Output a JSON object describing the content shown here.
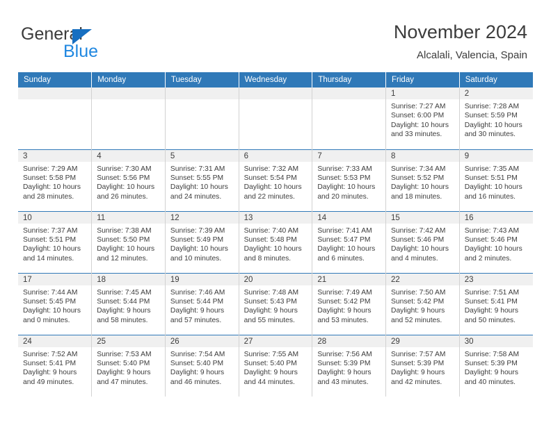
{
  "brand": {
    "name_top": "General",
    "name_bottom": "Blue",
    "accent_color": "#1f87e0",
    "triangle_color": "#176fc1"
  },
  "header": {
    "title": "November 2024",
    "subtitle": "Alcalali, Valencia, Spain",
    "header_bg": "#3079b8",
    "header_text_color": "#ffffff"
  },
  "weekdays": [
    "Sunday",
    "Monday",
    "Tuesday",
    "Wednesday",
    "Thursday",
    "Friday",
    "Saturday"
  ],
  "labels": {
    "sunrise": "Sunrise:",
    "sunset": "Sunset:",
    "daylight": "Daylight:"
  },
  "weeks": [
    [
      {
        "empty": true
      },
      {
        "empty": true
      },
      {
        "empty": true
      },
      {
        "empty": true
      },
      {
        "empty": true
      },
      {
        "day": "1",
        "sunrise": "Sunrise: 7:27 AM",
        "sunset": "Sunset: 6:00 PM",
        "daylight_line1": "Daylight: 10 hours",
        "daylight_line2": "and 33 minutes."
      },
      {
        "day": "2",
        "sunrise": "Sunrise: 7:28 AM",
        "sunset": "Sunset: 5:59 PM",
        "daylight_line1": "Daylight: 10 hours",
        "daylight_line2": "and 30 minutes."
      }
    ],
    [
      {
        "day": "3",
        "sunrise": "Sunrise: 7:29 AM",
        "sunset": "Sunset: 5:58 PM",
        "daylight_line1": "Daylight: 10 hours",
        "daylight_line2": "and 28 minutes."
      },
      {
        "day": "4",
        "sunrise": "Sunrise: 7:30 AM",
        "sunset": "Sunset: 5:56 PM",
        "daylight_line1": "Daylight: 10 hours",
        "daylight_line2": "and 26 minutes."
      },
      {
        "day": "5",
        "sunrise": "Sunrise: 7:31 AM",
        "sunset": "Sunset: 5:55 PM",
        "daylight_line1": "Daylight: 10 hours",
        "daylight_line2": "and 24 minutes."
      },
      {
        "day": "6",
        "sunrise": "Sunrise: 7:32 AM",
        "sunset": "Sunset: 5:54 PM",
        "daylight_line1": "Daylight: 10 hours",
        "daylight_line2": "and 22 minutes."
      },
      {
        "day": "7",
        "sunrise": "Sunrise: 7:33 AM",
        "sunset": "Sunset: 5:53 PM",
        "daylight_line1": "Daylight: 10 hours",
        "daylight_line2": "and 20 minutes."
      },
      {
        "day": "8",
        "sunrise": "Sunrise: 7:34 AM",
        "sunset": "Sunset: 5:52 PM",
        "daylight_line1": "Daylight: 10 hours",
        "daylight_line2": "and 18 minutes."
      },
      {
        "day": "9",
        "sunrise": "Sunrise: 7:35 AM",
        "sunset": "Sunset: 5:51 PM",
        "daylight_line1": "Daylight: 10 hours",
        "daylight_line2": "and 16 minutes."
      }
    ],
    [
      {
        "day": "10",
        "sunrise": "Sunrise: 7:37 AM",
        "sunset": "Sunset: 5:51 PM",
        "daylight_line1": "Daylight: 10 hours",
        "daylight_line2": "and 14 minutes."
      },
      {
        "day": "11",
        "sunrise": "Sunrise: 7:38 AM",
        "sunset": "Sunset: 5:50 PM",
        "daylight_line1": "Daylight: 10 hours",
        "daylight_line2": "and 12 minutes."
      },
      {
        "day": "12",
        "sunrise": "Sunrise: 7:39 AM",
        "sunset": "Sunset: 5:49 PM",
        "daylight_line1": "Daylight: 10 hours",
        "daylight_line2": "and 10 minutes."
      },
      {
        "day": "13",
        "sunrise": "Sunrise: 7:40 AM",
        "sunset": "Sunset: 5:48 PM",
        "daylight_line1": "Daylight: 10 hours",
        "daylight_line2": "and 8 minutes."
      },
      {
        "day": "14",
        "sunrise": "Sunrise: 7:41 AM",
        "sunset": "Sunset: 5:47 PM",
        "daylight_line1": "Daylight: 10 hours",
        "daylight_line2": "and 6 minutes."
      },
      {
        "day": "15",
        "sunrise": "Sunrise: 7:42 AM",
        "sunset": "Sunset: 5:46 PM",
        "daylight_line1": "Daylight: 10 hours",
        "daylight_line2": "and 4 minutes."
      },
      {
        "day": "16",
        "sunrise": "Sunrise: 7:43 AM",
        "sunset": "Sunset: 5:46 PM",
        "daylight_line1": "Daylight: 10 hours",
        "daylight_line2": "and 2 minutes."
      }
    ],
    [
      {
        "day": "17",
        "sunrise": "Sunrise: 7:44 AM",
        "sunset": "Sunset: 5:45 PM",
        "daylight_line1": "Daylight: 10 hours",
        "daylight_line2": "and 0 minutes."
      },
      {
        "day": "18",
        "sunrise": "Sunrise: 7:45 AM",
        "sunset": "Sunset: 5:44 PM",
        "daylight_line1": "Daylight: 9 hours",
        "daylight_line2": "and 58 minutes."
      },
      {
        "day": "19",
        "sunrise": "Sunrise: 7:46 AM",
        "sunset": "Sunset: 5:44 PM",
        "daylight_line1": "Daylight: 9 hours",
        "daylight_line2": "and 57 minutes."
      },
      {
        "day": "20",
        "sunrise": "Sunrise: 7:48 AM",
        "sunset": "Sunset: 5:43 PM",
        "daylight_line1": "Daylight: 9 hours",
        "daylight_line2": "and 55 minutes."
      },
      {
        "day": "21",
        "sunrise": "Sunrise: 7:49 AM",
        "sunset": "Sunset: 5:42 PM",
        "daylight_line1": "Daylight: 9 hours",
        "daylight_line2": "and 53 minutes."
      },
      {
        "day": "22",
        "sunrise": "Sunrise: 7:50 AM",
        "sunset": "Sunset: 5:42 PM",
        "daylight_line1": "Daylight: 9 hours",
        "daylight_line2": "and 52 minutes."
      },
      {
        "day": "23",
        "sunrise": "Sunrise: 7:51 AM",
        "sunset": "Sunset: 5:41 PM",
        "daylight_line1": "Daylight: 9 hours",
        "daylight_line2": "and 50 minutes."
      }
    ],
    [
      {
        "day": "24",
        "sunrise": "Sunrise: 7:52 AM",
        "sunset": "Sunset: 5:41 PM",
        "daylight_line1": "Daylight: 9 hours",
        "daylight_line2": "and 49 minutes."
      },
      {
        "day": "25",
        "sunrise": "Sunrise: 7:53 AM",
        "sunset": "Sunset: 5:40 PM",
        "daylight_line1": "Daylight: 9 hours",
        "daylight_line2": "and 47 minutes."
      },
      {
        "day": "26",
        "sunrise": "Sunrise: 7:54 AM",
        "sunset": "Sunset: 5:40 PM",
        "daylight_line1": "Daylight: 9 hours",
        "daylight_line2": "and 46 minutes."
      },
      {
        "day": "27",
        "sunrise": "Sunrise: 7:55 AM",
        "sunset": "Sunset: 5:40 PM",
        "daylight_line1": "Daylight: 9 hours",
        "daylight_line2": "and 44 minutes."
      },
      {
        "day": "28",
        "sunrise": "Sunrise: 7:56 AM",
        "sunset": "Sunset: 5:39 PM",
        "daylight_line1": "Daylight: 9 hours",
        "daylight_line2": "and 43 minutes."
      },
      {
        "day": "29",
        "sunrise": "Sunrise: 7:57 AM",
        "sunset": "Sunset: 5:39 PM",
        "daylight_line1": "Daylight: 9 hours",
        "daylight_line2": "and 42 minutes."
      },
      {
        "day": "30",
        "sunrise": "Sunrise: 7:58 AM",
        "sunset": "Sunset: 5:39 PM",
        "daylight_line1": "Daylight: 9 hours",
        "daylight_line2": "and 40 minutes."
      }
    ]
  ]
}
